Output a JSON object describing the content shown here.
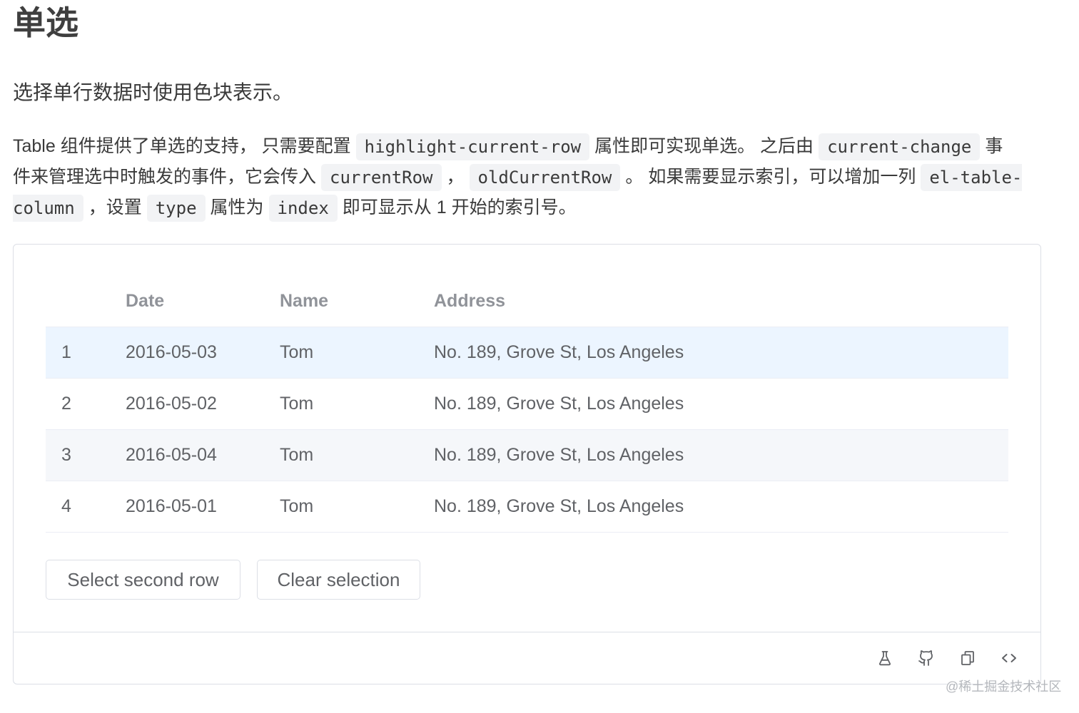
{
  "heading": "单选",
  "intro": "选择单行数据时使用色块表示。",
  "description": {
    "lines": [
      [
        {
          "text": "Table 组件提供了单选的支持， 只需要配置"
        },
        {
          "code": "highlight-current-row"
        },
        {
          "text": "属性即可实现单选。 之后由"
        },
        {
          "code": "current-change"
        },
        {
          "text": "事"
        }
      ],
      [
        {
          "text": "件来管理选中时触发的事件，它会传入"
        },
        {
          "code": "currentRow"
        },
        {
          "text": "，"
        },
        {
          "code": "oldCurrentRow"
        },
        {
          "text": "。 如果需要显示索引，可以增加一列"
        },
        {
          "code": "el-table-"
        }
      ],
      [
        {
          "code": "column"
        },
        {
          "text": "，设置"
        },
        {
          "code": "type"
        },
        {
          "text": "属性为"
        },
        {
          "code": "index"
        },
        {
          "text": "即可显示从 1 开始的索引号。"
        }
      ]
    ]
  },
  "demo": {
    "table": {
      "columns": {
        "date": "Date",
        "name": "Name",
        "address": "Address"
      },
      "rows": [
        {
          "index": 1,
          "date": "2016-05-03",
          "name": "Tom",
          "address": "No. 189, Grove St, Los Angeles",
          "highlighted": true,
          "hovered": false
        },
        {
          "index": 2,
          "date": "2016-05-02",
          "name": "Tom",
          "address": "No. 189, Grove St, Los Angeles",
          "highlighted": false,
          "hovered": false
        },
        {
          "index": 3,
          "date": "2016-05-04",
          "name": "Tom",
          "address": "No. 189, Grove St, Los Angeles",
          "highlighted": false,
          "hovered": true
        },
        {
          "index": 4,
          "date": "2016-05-01",
          "name": "Tom",
          "address": "No. 189, Grove St, Los Angeles",
          "highlighted": false,
          "hovered": false
        }
      ]
    },
    "buttons": {
      "select_second_row": "Select second row",
      "clear_selection": "Clear selection"
    },
    "toolbar": {
      "icons": [
        "flask-icon",
        "github-icon",
        "copy-icon",
        "code-icon"
      ]
    }
  },
  "watermark": "@稀土掘金技术社区",
  "colors": {
    "current_row_bg": "#ecf5ff",
    "hover_row_bg": "#f5f7fa",
    "table_border": "#ebeef5",
    "box_border": "#dcdfe6",
    "header_text": "#909399",
    "cell_text": "#606266",
    "code_bg": "#f2f3f5"
  }
}
